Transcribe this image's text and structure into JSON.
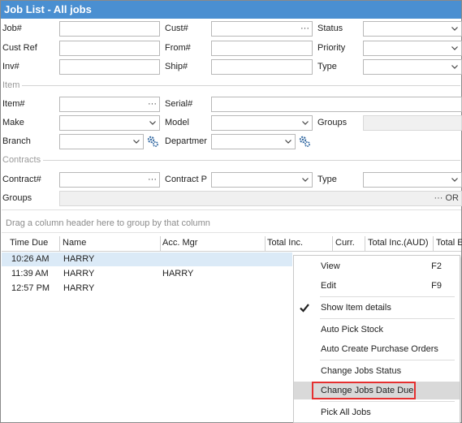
{
  "window": {
    "title": "Job List - All jobs"
  },
  "filters": {
    "job_label": "Job#",
    "cust_ref_label": "Cust Ref",
    "inv_label": "Inv#",
    "cust_label": "Cust#",
    "from_label": "From#",
    "ship_label": "Ship#",
    "status_label": "Status",
    "priority_label": "Priority",
    "type_label": "Type",
    "item_group": "Item",
    "item_label": "Item#",
    "serial_label": "Serial#",
    "make_label": "Make",
    "model_label": "Model",
    "groups_label": "Groups",
    "branch_label": "Branch",
    "department_label": "Departmer",
    "contracts_group": "Contracts",
    "contract_label": "Contract#",
    "contract_p_label": "Contract P",
    "contract_type_label": "Type",
    "contract_groups_label": "Groups",
    "ellipsis": "···",
    "ellipsis_or": "··· OR"
  },
  "grid": {
    "drag_hint": "Drag a column header here to group by that column",
    "columns": [
      "Time Due",
      "Name",
      "Acc. Mgr",
      "Total Inc.",
      "Curr.",
      "Total Inc.(AUD)",
      "Total E"
    ],
    "rows": [
      {
        "time_due": "10:26 AM",
        "name": "HARRY",
        "acc_mgr": ""
      },
      {
        "time_due": "11:39 AM",
        "name": "HARRY",
        "acc_mgr": "HARRY"
      },
      {
        "time_due": "12:57 PM",
        "name": "HARRY",
        "acc_mgr": ""
      }
    ]
  },
  "context_menu": {
    "view": {
      "label": "View",
      "shortcut": "F2"
    },
    "edit": {
      "label": "Edit",
      "shortcut": "F9"
    },
    "show_item_details": {
      "label": "Show Item details",
      "checked": true
    },
    "auto_pick_stock": {
      "label": "Auto Pick Stock"
    },
    "auto_create_po": {
      "label": "Auto Create Purchase Orders"
    },
    "change_jobs_status": {
      "label": "Change Jobs Status"
    },
    "change_jobs_date_due": {
      "label": "Change Jobs Date Due",
      "highlighted": true
    },
    "pick_all_jobs": {
      "label": "Pick All Jobs"
    }
  },
  "colors": {
    "title_bar": "#4a8fd1",
    "selected_row": "#dbeaf7",
    "highlight_box": "#e53030"
  }
}
